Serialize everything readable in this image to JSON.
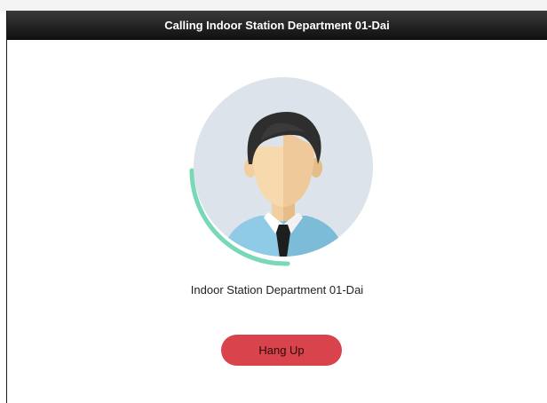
{
  "dialog": {
    "title": "Calling Indoor Station Department 01-Dai"
  },
  "callee": {
    "name": "Indoor Station Department 01-Dai",
    "avatar_icon": "person-avatar-icon",
    "progress_icon": "calling-progress-ring-icon"
  },
  "actions": {
    "hang_up_label": "Hang Up"
  },
  "colors": {
    "titlebar": "#1b1b1b",
    "avatar_background": "#dde3ea",
    "progress_ring": "#79d8b7",
    "hang_up_button": "#d8434c"
  }
}
